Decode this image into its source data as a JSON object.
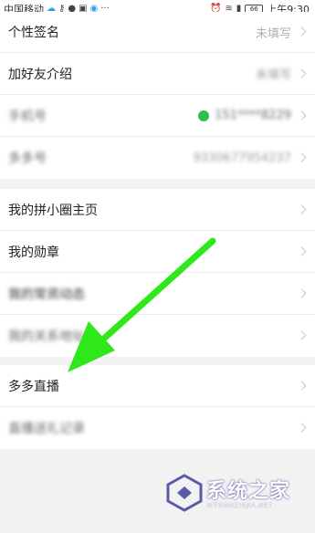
{
  "status_bar": {
    "carrier": "中国移动",
    "icons_left": [
      "cloud-icon",
      "key-icon",
      "chat-icon",
      "app-icon",
      "circle-icon",
      "more-icon"
    ],
    "more": "···",
    "battery": "66",
    "time": "上午9:30"
  },
  "profile_section": {
    "rows": [
      {
        "label": "个性签名",
        "value": "未填写"
      },
      {
        "label": "加好友介绍",
        "value": "未填写"
      },
      {
        "label": "手机号",
        "value": "151****8229"
      },
      {
        "label": "多多号",
        "value": "9330677954237"
      }
    ]
  },
  "links_section": {
    "rows": [
      {
        "label": "我的拼小圈主页"
      },
      {
        "label": "我的勋章"
      },
      {
        "label": "我的常资动态"
      },
      {
        "label": "我的关系地址"
      }
    ]
  },
  "live_section": {
    "rows": [
      {
        "label": "多多直播"
      },
      {
        "label": "直播送礼记录"
      }
    ]
  },
  "watermark": {
    "title": "系统之家",
    "subtitle": "XITONGZHIJIA.NET"
  },
  "colors": {
    "arrow": "#2ee81a",
    "phone_badge": "#27c24c",
    "watermark_logo": "#5a5aa8"
  }
}
